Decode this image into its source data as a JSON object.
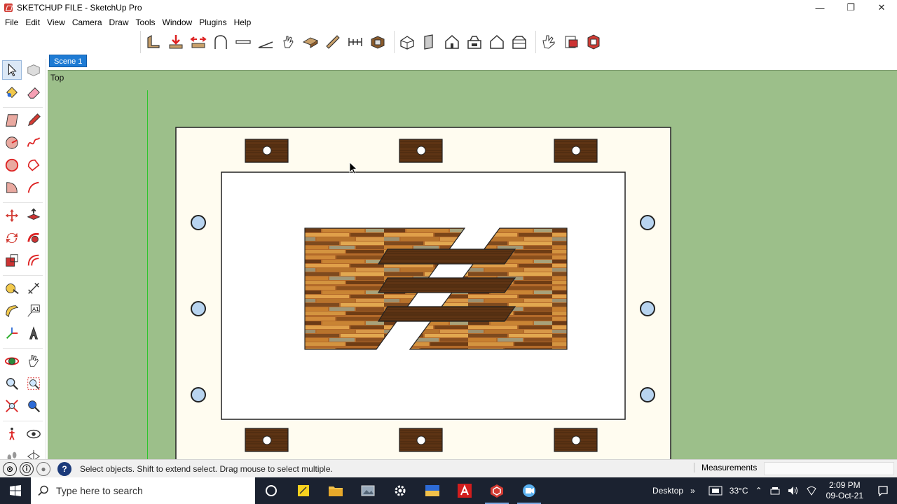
{
  "window": {
    "title": "SKETCHUP FILE - SketchUp Pro",
    "minimize": "—",
    "restore": "❐",
    "close": "✕"
  },
  "menu": [
    "File",
    "Edit",
    "View",
    "Camera",
    "Draw",
    "Tools",
    "Window",
    "Plugins",
    "Help"
  ],
  "scene": {
    "tab_label": "Scene 1",
    "view_label": "Top"
  },
  "status": {
    "message": "Select objects. Shift to extend select. Drag mouse to select multiple.",
    "measurements_label": "Measurements",
    "measurements_value": ""
  },
  "taskbar": {
    "search_placeholder": "Type here to search",
    "desktop_label": "Desktop",
    "temperature": "33°C",
    "time": "2:09 PM",
    "date": "09-Oct-21"
  },
  "colors": {
    "viewport_bg": "#9cbf8a",
    "scene_tab": "#1e7bd4",
    "wood_dark": "#5a2f12",
    "board_bg": "#fffcf0",
    "hole_fill": "#b8d4f0"
  }
}
